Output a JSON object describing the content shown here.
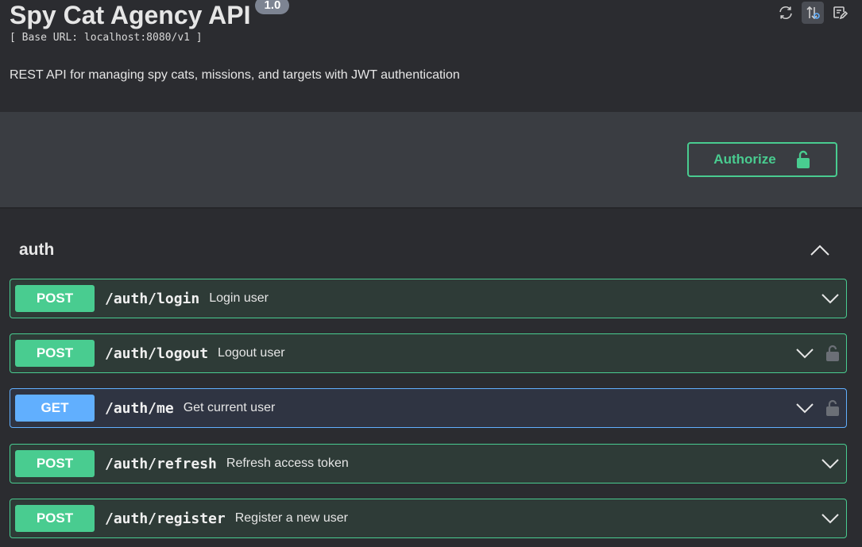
{
  "header": {
    "title": "Spy Cat Agency API",
    "version": "1.0",
    "base_url": "[ Base URL: localhost:8080/v1 ]",
    "description": "REST API for managing spy cats, missions, and targets with JWT authentication"
  },
  "toolbar": {
    "icons": [
      "refresh-icon",
      "sort-icon",
      "edit-icon"
    ]
  },
  "authorize": {
    "label": "Authorize",
    "icon": "unlock-icon",
    "color": "#49cc90"
  },
  "section": {
    "title": "auth",
    "operations": [
      {
        "method": "POST",
        "path": "/auth/login",
        "summary": "Login user",
        "locked": false
      },
      {
        "method": "POST",
        "path": "/auth/logout",
        "summary": "Logout user",
        "locked": true
      },
      {
        "method": "GET",
        "path": "/auth/me",
        "summary": "Get current user",
        "locked": true
      },
      {
        "method": "POST",
        "path": "/auth/refresh",
        "summary": "Refresh access token",
        "locked": false
      },
      {
        "method": "POST",
        "path": "/auth/register",
        "summary": "Register a new user",
        "locked": false
      }
    ]
  },
  "colors": {
    "post": "#49cc90",
    "get": "#61affe",
    "background": "#2b2c30"
  }
}
